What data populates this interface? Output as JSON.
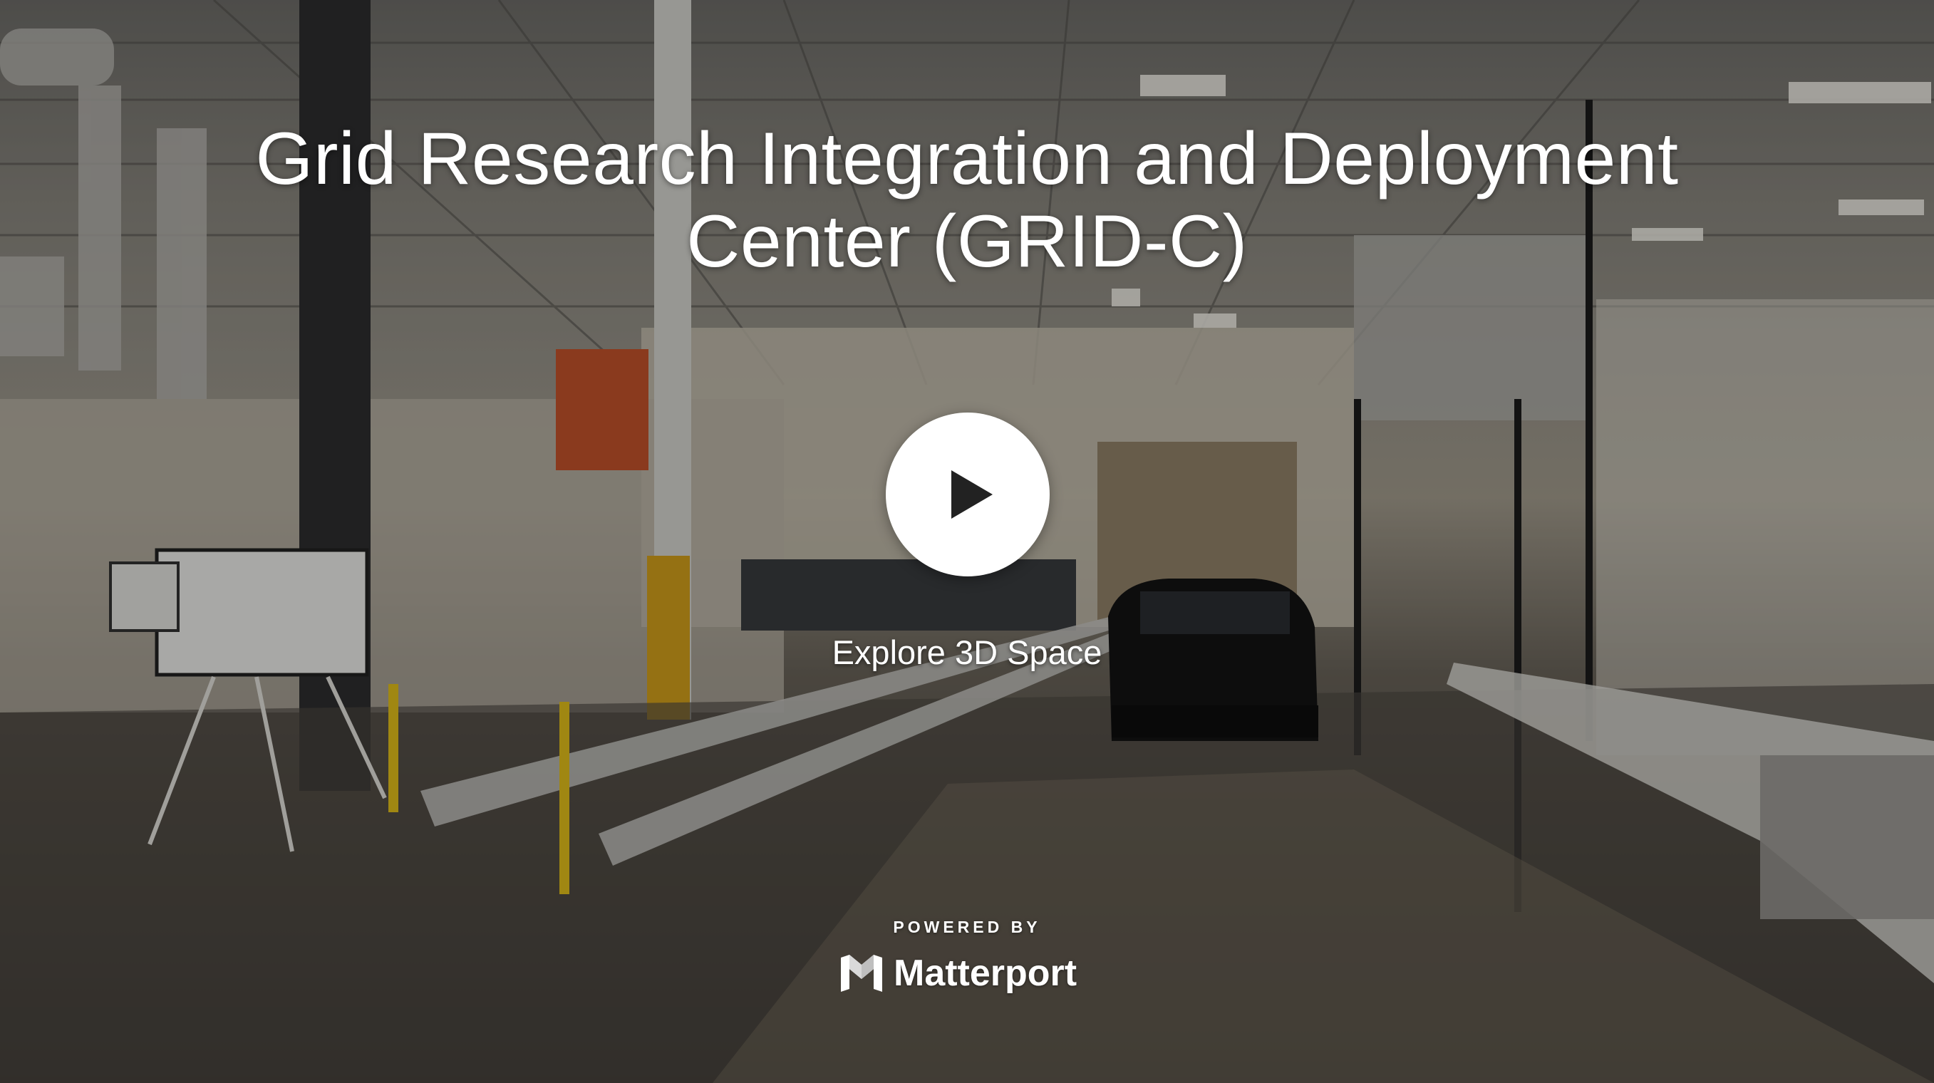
{
  "tour": {
    "title": "Grid Research Integration and Deployment Center (GRID-C)",
    "explore_label": "Explore 3D Space",
    "play_icon": "play-icon"
  },
  "branding": {
    "powered_by": "POWERED BY",
    "name": "Matterport",
    "logo_icon": "matterport-logo-icon"
  },
  "colors": {
    "overlay_text": "#ffffff",
    "play_button_bg": "#ffffff",
    "play_glyph": "#222222"
  }
}
